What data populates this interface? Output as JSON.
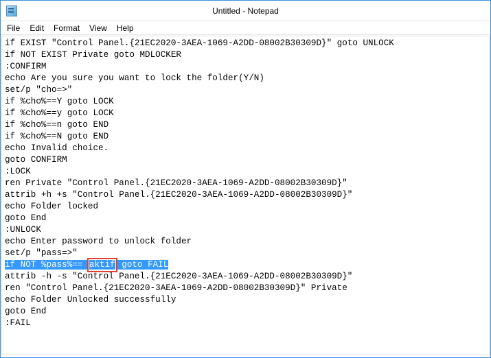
{
  "window": {
    "title": "Untitled - Notepad"
  },
  "menu": {
    "file": "File",
    "edit": "Edit",
    "format": "Format",
    "view": "View",
    "help": "Help"
  },
  "code": {
    "l0": "if EXIST \"Control Panel.{21EC2020-3AEA-1069-A2DD-08002B30309D}\" goto UNLOCK",
    "l1": "if NOT EXIST Private goto MDLOCKER",
    "l2": ":CONFIRM",
    "l3": "echo Are you sure you want to lock the folder(Y/N)",
    "l4": "set/p \"cho=>\"",
    "l5": "if %cho%==Y goto LOCK",
    "l6": "if %cho%==y goto LOCK",
    "l7": "if %cho%==n goto END",
    "l8": "if %cho%==N goto END",
    "l9": "echo Invalid choice.",
    "l10": "goto CONFIRM",
    "l11": ":LOCK",
    "l12": "ren Private \"Control Panel.{21EC2020-3AEA-1069-A2DD-08002B30309D}\"",
    "l13": "attrib +h +s \"Control Panel.{21EC2020-3AEA-1069-A2DD-08002B30309D}\"",
    "l14": "echo Folder locked",
    "l15": "goto End",
    "l16": ":UNLOCK",
    "l17": "echo Enter password to unlock folder",
    "l18": "set/p \"pass=>\"",
    "l19a": "if NOT %pass%== ",
    "l19b": "aktif",
    "l19c": " goto FAIL",
    "l20": "attrib -h -s \"Control Panel.{21EC2020-3AEA-1069-A2DD-08002B30309D}\"",
    "l21": "ren \"Control Panel.{21EC2020-3AEA-1069-A2DD-08002B30309D}\" Private",
    "l22": "echo Folder Unlocked successfully",
    "l23": "goto End",
    "l24": ":FAIL"
  }
}
